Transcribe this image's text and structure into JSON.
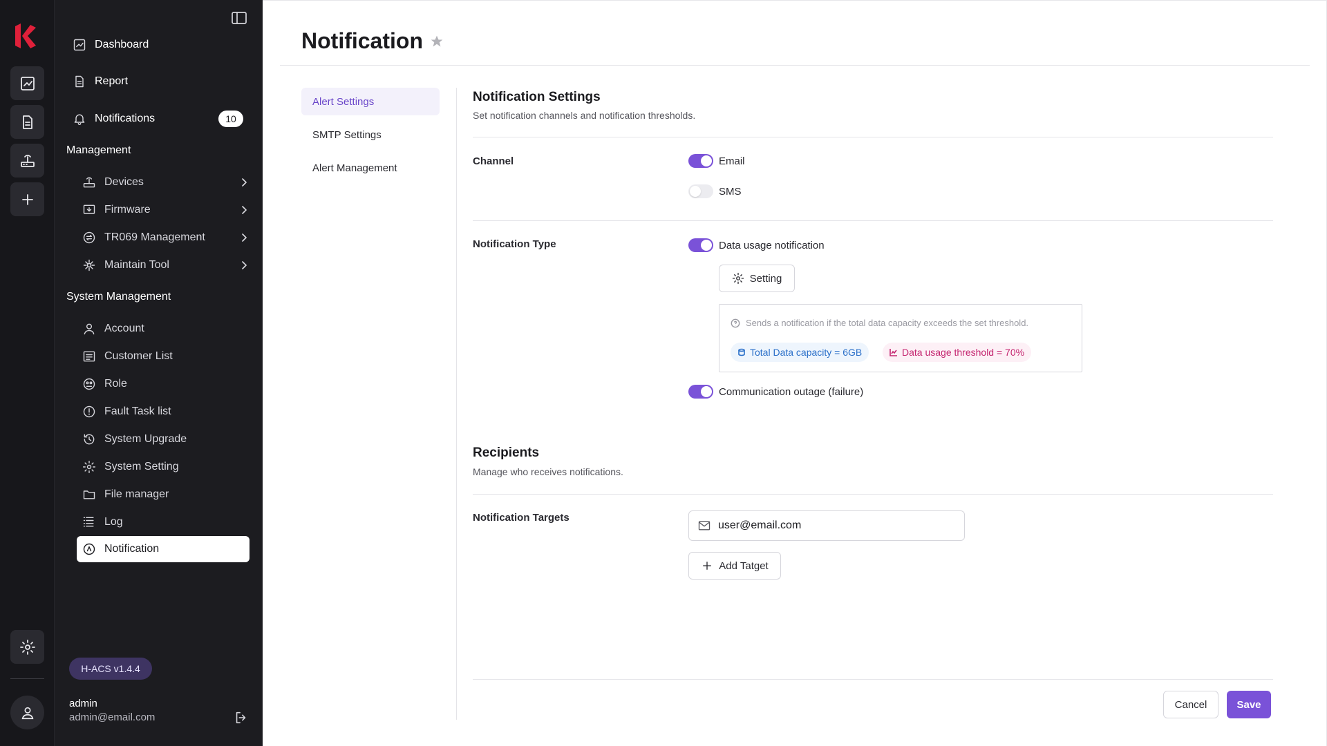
{
  "rail": {
    "icons": [
      "logo",
      "chart-icon",
      "report-icon",
      "router-icon",
      "plus-icon",
      "gear-icon",
      "user-icon"
    ]
  },
  "sidebar": {
    "top_items": [
      {
        "label": "Dashboard",
        "icon": "chart-icon"
      },
      {
        "label": "Report",
        "icon": "report-icon"
      },
      {
        "label": "Notifications",
        "icon": "bell-icon",
        "badge": "10"
      }
    ],
    "management_title": "Management",
    "management_items": [
      {
        "label": "Devices",
        "icon": "router-icon"
      },
      {
        "label": "Firmware",
        "icon": "firmware-icon"
      },
      {
        "label": "TR069 Management",
        "icon": "sync-icon"
      },
      {
        "label": "Maintain Tool",
        "icon": "tool-icon"
      }
    ],
    "system_title": "System Management",
    "system_items": [
      {
        "label": "Account",
        "icon": "user-icon"
      },
      {
        "label": "Customer List",
        "icon": "list-icon"
      },
      {
        "label": "Role",
        "icon": "role-icon"
      },
      {
        "label": "Fault Task list",
        "icon": "alert-icon"
      },
      {
        "label": "System Upgrade",
        "icon": "history-icon"
      },
      {
        "label": "System Setting",
        "icon": "gear-icon"
      },
      {
        "label": "File manager",
        "icon": "folder-icon"
      },
      {
        "label": "Log",
        "icon": "log-icon"
      },
      {
        "label": "Notification",
        "icon": "notification-icon",
        "active": true
      }
    ],
    "version": "H-ACS v1.4.4",
    "user_name": "admin",
    "user_email": "admin@email.com"
  },
  "page": {
    "title": "Notification",
    "tabs": [
      {
        "label": "Alert Settings",
        "active": true
      },
      {
        "label": "SMTP Settings"
      },
      {
        "label": "Alert Management"
      }
    ],
    "notification_settings": {
      "title": "Notification Settings",
      "subtitle": "Set notification channels and notification thresholds.",
      "channel_label": "Channel",
      "channels": [
        {
          "label": "Email",
          "enabled": true
        },
        {
          "label": "SMS",
          "enabled": false
        }
      ],
      "type_label": "Notification Type",
      "types": [
        {
          "label": "Data usage notification",
          "enabled": true
        },
        {
          "label": "Communication outage (failure)",
          "enabled": true
        }
      ],
      "setting_button": "Setting",
      "info_text": "Sends a notification if the total data capacity exceeds the set threshold.",
      "chip_capacity": "Total Data capacity = 6GB",
      "chip_threshold": "Data usage threshold = 70%"
    },
    "recipients": {
      "title": "Recipients",
      "subtitle": "Manage who receives notifications.",
      "targets_label": "Notification Targets",
      "target_value": "user@email.com",
      "add_button": "Add Tatget"
    },
    "actions": {
      "cancel": "Cancel",
      "save": "Save"
    }
  },
  "colors": {
    "accent": "#7a52d8",
    "sidebar_bg": "#1c1c20",
    "rail_bg": "#17171b",
    "brand": "#e0203a"
  }
}
